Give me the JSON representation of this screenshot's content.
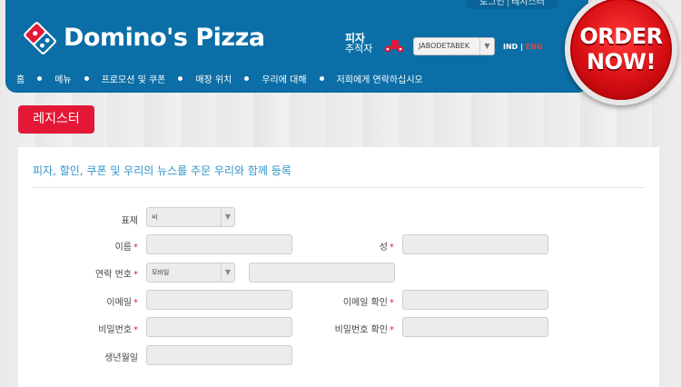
{
  "header": {
    "top_links": {
      "login": "로그인",
      "separator": "|",
      "register": "레지스터"
    },
    "brand": "Domino's Pizza",
    "tracker": {
      "line1": "피자",
      "line2": "추적자"
    },
    "region_select": {
      "value": "JABODETABEK",
      "arrow": "▼"
    },
    "lang": {
      "active": "IND",
      "separator": "|",
      "other": "ENG"
    },
    "nav": [
      "홈",
      "메뉴",
      "프로모션 및 쿠폰",
      "매장 위치",
      "우리에 대해",
      "저희에게 연락하십시오"
    ],
    "order_button": {
      "line1": "ORDER",
      "line2": "NOW!"
    }
  },
  "page": {
    "register_tag": "레지스터",
    "headline": "피자, 할인, 쿠폰 및 우리의 뉴스를 주문 우리와 함께 등록"
  },
  "form": {
    "required_mark": "*",
    "title_label": "표제",
    "title_value": "씨",
    "first_name_label": "이름",
    "last_name_label": "성",
    "phone_label": "연락 번호",
    "phone_type_value": "모바일",
    "email_label": "이메일",
    "email_confirm_label": "이메일 확인",
    "password_label": "비밀번호",
    "password_confirm_label": "비밀번호 확인",
    "dob_label": "생년월일",
    "arrow": "▼"
  },
  "colors": {
    "header_blue": "#0b6ea6",
    "brand_red": "#e31837",
    "headline_blue": "#2f94c9"
  }
}
